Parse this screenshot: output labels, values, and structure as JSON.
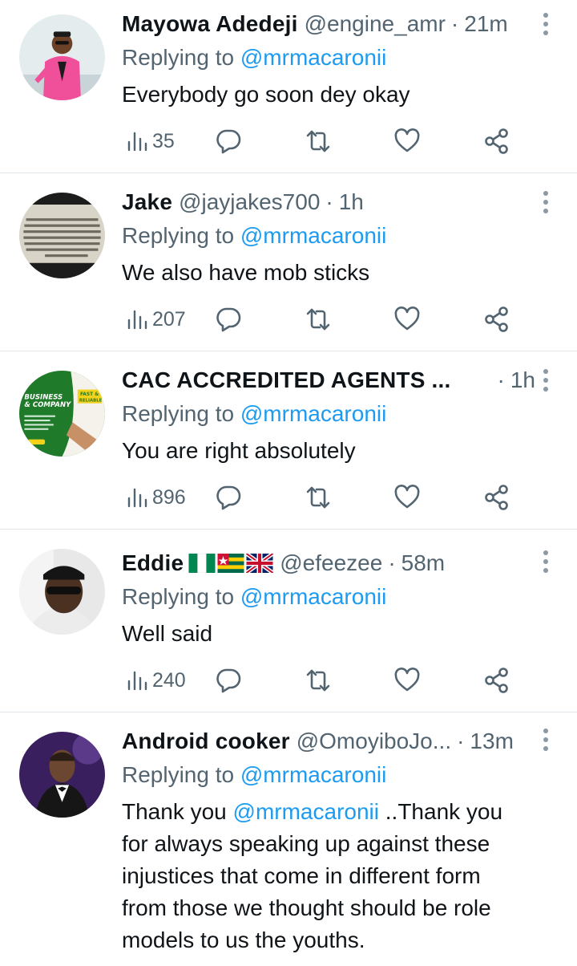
{
  "tweets": [
    {
      "name": "Mayowa Adedeji",
      "handle": "@engine_amr",
      "time": "21m",
      "reply_prefix": "Replying to",
      "reply_to": "@mrmacaronii",
      "text": "Everybody go soon dey okay",
      "views": "35",
      "avatar": "man-in-pink-suit"
    },
    {
      "name": "Jake",
      "handle": "@jayjakes700",
      "time": "1h",
      "reply_prefix": "Replying to",
      "reply_to": "@mrmacaronii",
      "text": "We also have mob sticks",
      "views": "207",
      "avatar": "quote-newspaper-clipping"
    },
    {
      "name": "CAC ACCREDITED  AGENTS ...",
      "handle": "",
      "time": "1h",
      "reply_prefix": "Replying to",
      "reply_to": "@mrmacaronii",
      "text": "You are right absolutely",
      "views": "896",
      "avatar": "business-company-flyer",
      "avatar_text": [
        "BUSINESS",
        "& COMPANY",
        "FAST &",
        "RELIABLE"
      ]
    },
    {
      "name": "Eddie",
      "handle": "@efeezee",
      "time": "58m",
      "reply_prefix": "Replying to",
      "reply_to": "@mrmacaronii",
      "text": "Well said",
      "views": "240",
      "avatar": "man-with-sunglasses",
      "flags": [
        "nigeria-flag",
        "togo-flag",
        "uk-flag"
      ]
    },
    {
      "name": "Android cooker",
      "handle": "@OmoyiboJo...",
      "time": "13m",
      "reply_prefix": "Replying to",
      "reply_to": "@mrmacaronii",
      "text_prefix": "Thank you",
      "text_mention": "@mrmacaronii",
      "text_lines": [
        "..Thank you",
        "for always speaking up against these",
        "injustices that come in different form",
        "from those we thought should be role",
        "models to us the youths."
      ],
      "avatar": "man-in-tuxedo"
    }
  ],
  "icons": {
    "views": "views-icon",
    "reply": "reply-icon",
    "retweet": "retweet-icon",
    "like": "like-icon",
    "share": "share-icon",
    "more": "more-vertical-icon"
  },
  "colors": {
    "text": "#0f1419",
    "secondary": "#536471",
    "accent": "#1d9bf0",
    "divider": "#e1e6ea"
  }
}
